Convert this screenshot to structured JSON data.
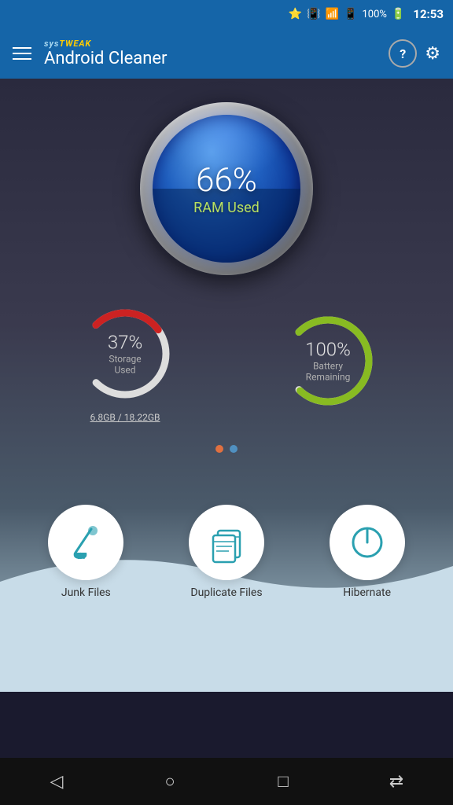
{
  "statusBar": {
    "battery": "100%",
    "time": "12:53",
    "icons": [
      "bluetooth",
      "vibrate",
      "wifi",
      "sim"
    ]
  },
  "appBar": {
    "brand": "sysTWEAK",
    "title": "Android Cleaner",
    "helpLabel": "?",
    "settingsLabel": "⚙"
  },
  "ramGauge": {
    "percent": "66%",
    "label": "RAM Used"
  },
  "storageGauge": {
    "percent": "37%",
    "label": "Storage Used",
    "detail": "6.8GB / 18.22GB",
    "trackColor": "#ddd",
    "fillColor": "#cc2222"
  },
  "batteryGauge": {
    "percent": "100%",
    "label": "Battery Remaining",
    "trackColor": "#ddd",
    "fillColor": "#88bb22"
  },
  "pagination": {
    "dots": [
      "active",
      "inactive"
    ]
  },
  "actions": [
    {
      "id": "junk-files",
      "label": "Junk Files",
      "icon": "broom"
    },
    {
      "id": "duplicate-files",
      "label": "Duplicate Files",
      "icon": "files"
    },
    {
      "id": "hibernate",
      "label": "Hibernate",
      "icon": "power"
    }
  ],
  "navBar": {
    "back": "◁",
    "home": "○",
    "recent": "□",
    "cast": "⇄"
  }
}
